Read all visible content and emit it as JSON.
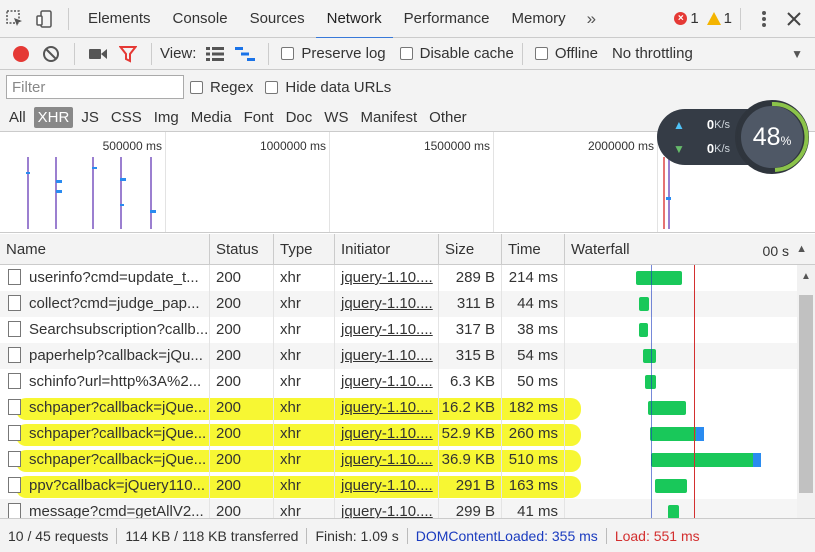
{
  "tabs": {
    "items": [
      "Elements",
      "Console",
      "Sources",
      "Network",
      "Performance",
      "Memory"
    ],
    "more": "»",
    "errors": "1",
    "warnings": "1"
  },
  "toolbar": {
    "view_label": "View:",
    "preserve_log": "Preserve log",
    "disable_cache": "Disable cache",
    "offline": "Offline",
    "throttling": "No throttling"
  },
  "filter": {
    "placeholder": "Filter",
    "regex": "Regex",
    "hide_data_urls": "Hide data URLs"
  },
  "types": [
    "All",
    "XHR",
    "JS",
    "CSS",
    "Img",
    "Media",
    "Font",
    "Doc",
    "WS",
    "Manifest",
    "Other"
  ],
  "overview": {
    "ticks": [
      "500000 ms",
      "1000000 ms",
      "1500000 ms",
      "2000000 ms"
    ]
  },
  "speed": {
    "up": "0",
    "down": "0",
    "unit": "K/s",
    "percent": "48",
    "percent_sign": "%"
  },
  "columns": {
    "name": "Name",
    "status": "Status",
    "type": "Type",
    "initiator": "Initiator",
    "size": "Size",
    "time": "Time",
    "waterfall": "Waterfall",
    "waterfall_tick": "00 s"
  },
  "requests": [
    {
      "name": "userinfo?cmd=update_t...",
      "status": "200",
      "type": "xhr",
      "initiator": "jquery-1.10....",
      "size": "289 B",
      "time": "214 ms",
      "wf_start": 636,
      "wf_len": 46,
      "highlight": false
    },
    {
      "name": "collect?cmd=judge_pap...",
      "status": "200",
      "type": "xhr",
      "initiator": "jquery-1.10....",
      "size": "311 B",
      "time": "44 ms",
      "wf_start": 639,
      "wf_len": 10,
      "highlight": false
    },
    {
      "name": "Searchsubscription?callb...",
      "status": "200",
      "type": "xhr",
      "initiator": "jquery-1.10....",
      "size": "317 B",
      "time": "38 ms",
      "wf_start": 639,
      "wf_len": 9,
      "highlight": false
    },
    {
      "name": "paperhelp?callback=jQu...",
      "status": "200",
      "type": "xhr",
      "initiator": "jquery-1.10....",
      "size": "315 B",
      "time": "54 ms",
      "wf_start": 643,
      "wf_len": 13,
      "highlight": false
    },
    {
      "name": "schinfo?url=http%3A%2...",
      "status": "200",
      "type": "xhr",
      "initiator": "jquery-1.10....",
      "size": "6.3 KB",
      "time": "50 ms",
      "wf_start": 645,
      "wf_len": 11,
      "highlight": false
    },
    {
      "name": "schpaper?callback=jQue...",
      "status": "200",
      "type": "xhr",
      "initiator": "jquery-1.10....",
      "size": "16.2 KB",
      "time": "182 ms",
      "wf_start": 648,
      "wf_len": 38,
      "highlight": true
    },
    {
      "name": "schpaper?callback=jQue...",
      "status": "200",
      "type": "xhr",
      "initiator": "jquery-1.10....",
      "size": "52.9 KB",
      "time": "260 ms",
      "wf_start": 650,
      "wf_len": 54,
      "highlight": true
    },
    {
      "name": "schpaper?callback=jQue...",
      "status": "200",
      "type": "xhr",
      "initiator": "jquery-1.10....",
      "size": "36.9 KB",
      "time": "510 ms",
      "wf_start": 651,
      "wf_len": 110,
      "highlight": true
    },
    {
      "name": "ppv?callback=jQuery110...",
      "status": "200",
      "type": "xhr",
      "initiator": "jquery-1.10....",
      "size": "291 B",
      "time": "163 ms",
      "wf_start": 655,
      "wf_len": 32,
      "highlight": true
    },
    {
      "name": "message?cmd=getAllV2...",
      "status": "200",
      "type": "xhr",
      "initiator": "jquery-1.10....",
      "size": "299 B",
      "time": "41 ms",
      "wf_start": 668,
      "wf_len": 11,
      "highlight": false
    }
  ],
  "status": {
    "requests": "10 / 45 requests",
    "transferred": "114 KB / 118 KB transferred",
    "finish": "Finish: 1.09 s",
    "dcl": "DOMContentLoaded: 355 ms",
    "load": "Load: 551 ms",
    "dcl_color": "#1a3bbf",
    "load_color": "#d32f2f"
  }
}
